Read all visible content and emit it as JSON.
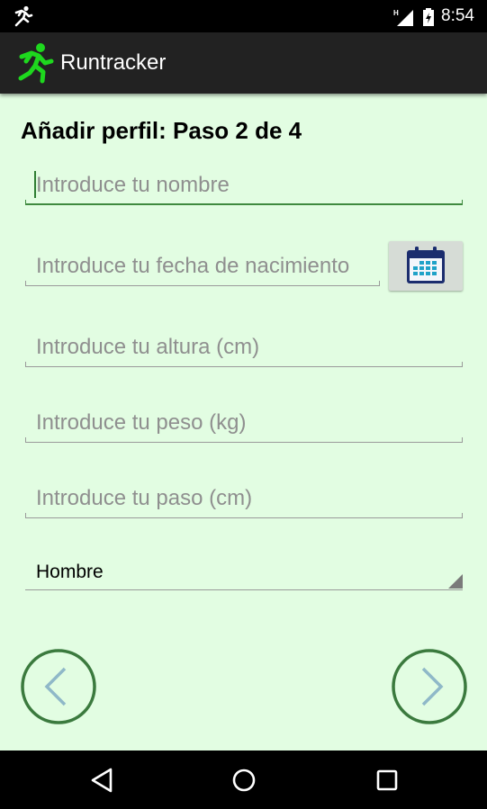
{
  "status_bar": {
    "time": "8:54",
    "network_label": "H",
    "icons": [
      "runner-notification-icon",
      "signal-icon",
      "battery-charging-icon"
    ]
  },
  "app_bar": {
    "title": "Runtracker",
    "logo_icon": "running-man-icon",
    "logo_color": "#1ed81e"
  },
  "form": {
    "heading": "Añadir perfil: Paso 2 de 4",
    "name_placeholder": "Introduce tu nombre",
    "birthdate_placeholder": "Introduce tu fecha de nacimiento",
    "height_placeholder": "Introduce tu altura (cm)",
    "weight_placeholder": "Introduce tu peso (kg)",
    "step_placeholder": "Introduce tu paso (cm)",
    "gender_selected": "Hombre",
    "calendar_icon": "calendar-icon"
  },
  "navigation": {
    "back_icon": "chevron-left-icon",
    "next_icon": "chevron-right-icon",
    "circle_color": "#3b7a3e",
    "chevron_color": "#8fb8c8"
  },
  "system_nav": {
    "icons": [
      "back-triangle-icon",
      "home-circle-icon",
      "recents-square-icon"
    ]
  },
  "colors": {
    "background": "#e2fde2",
    "accent": "#3f8a3f",
    "app_bar": "#222222"
  }
}
